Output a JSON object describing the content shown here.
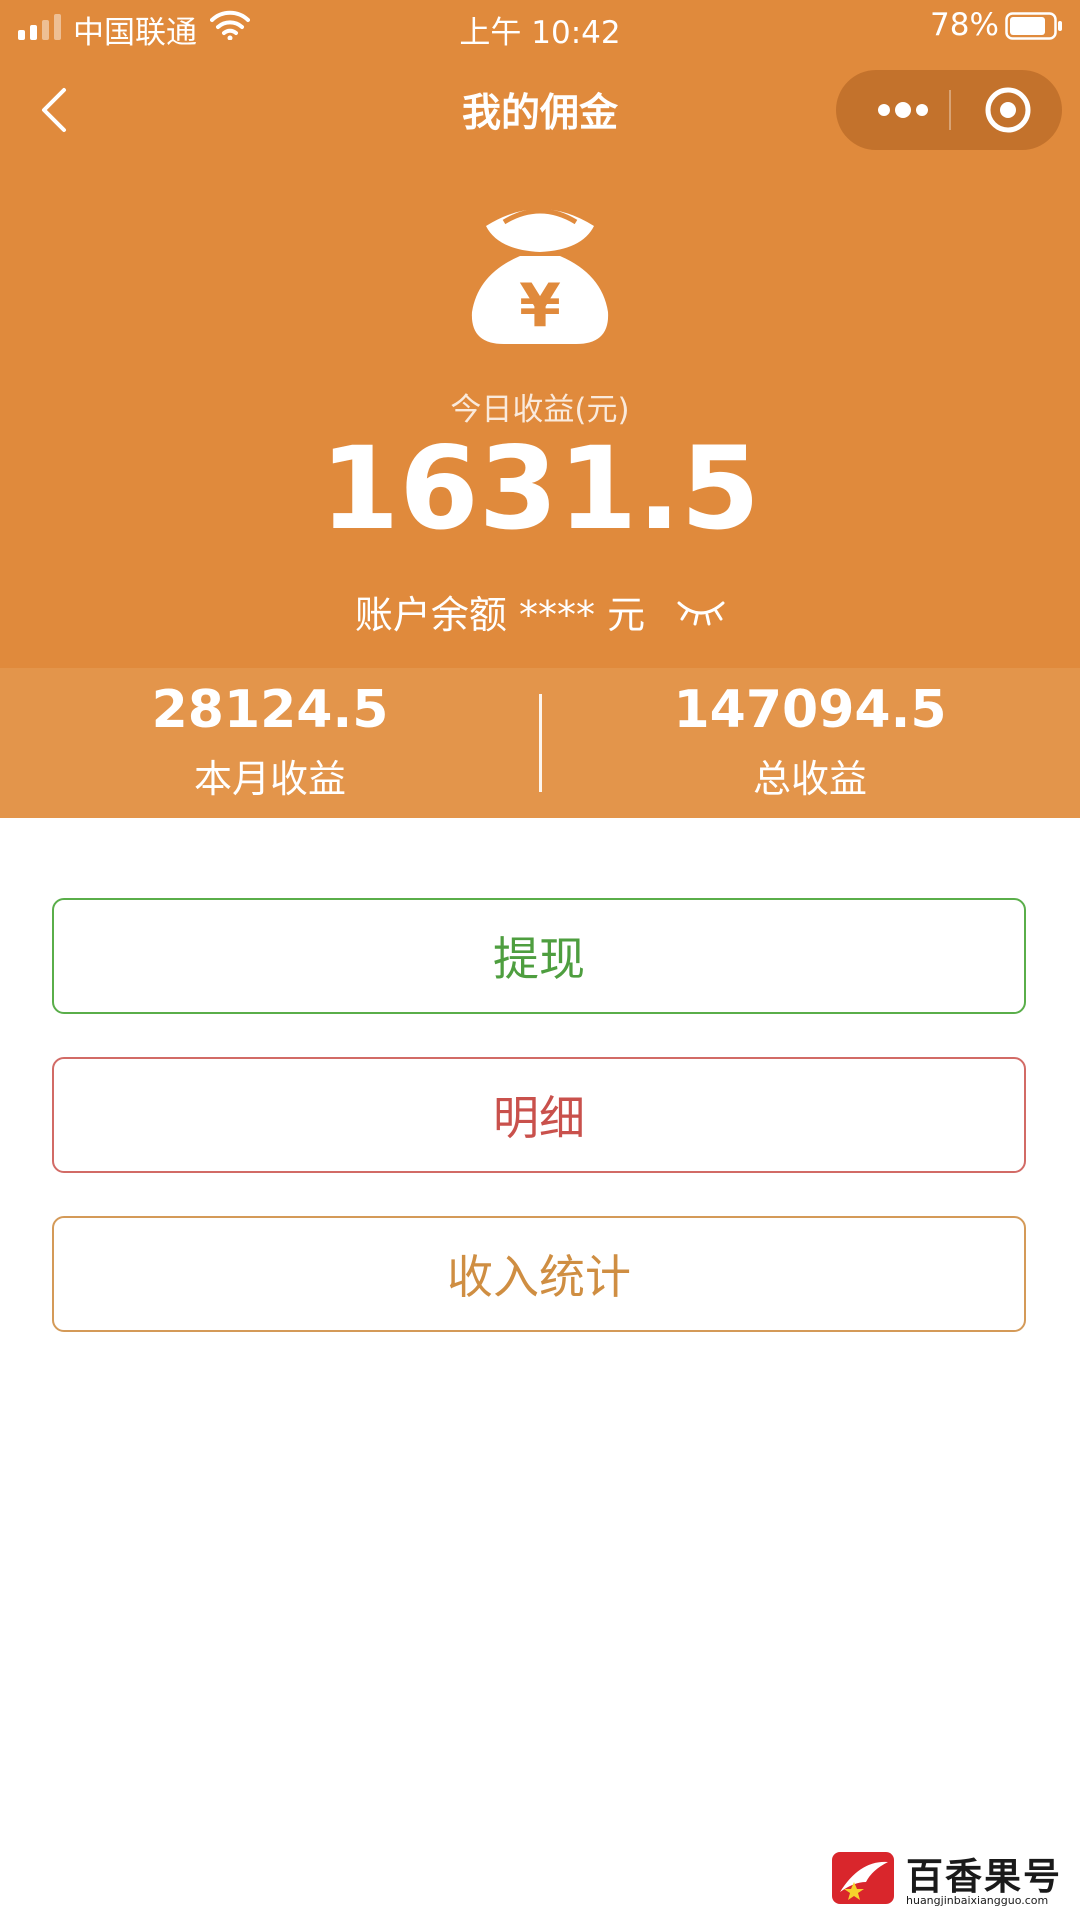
{
  "status_bar": {
    "carrier": "中国联通",
    "time": "上午 10:42",
    "battery_percent": "78%"
  },
  "nav": {
    "title": "我的佣金"
  },
  "summary": {
    "today_label": "今日收益(元)",
    "today_value": "1631.5",
    "balance_text": "账户余额 **** 元"
  },
  "stats": {
    "month_value": "28124.5",
    "month_label": "本月收益",
    "total_value": "147094.5",
    "total_label": "总收益"
  },
  "actions": {
    "withdraw": "提现",
    "details": "明细",
    "income_stats": "收入统计"
  },
  "watermark": {
    "brand": "百香果号",
    "url": "huangjinbaixiangguo.com"
  },
  "colors": {
    "header_bg": "#e08a3c",
    "stats_bg": "#e3954b",
    "withdraw": "#5aae4a",
    "details": "#d26b66",
    "income_stats": "#d49a58"
  },
  "icons": {
    "back": "chevron-left-icon",
    "more": "more-dots-icon",
    "close": "target-circle-icon",
    "money_bag": "money-bag-icon",
    "hide_balance": "closed-eye-icon"
  }
}
